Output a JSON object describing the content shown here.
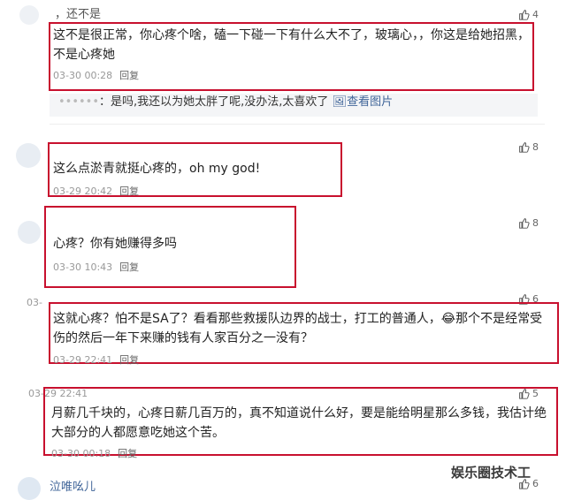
{
  "comments": [
    {
      "username": "，还不是",
      "text": "这不是很正常，你心疼个啥，磕一下碰一下有什么大不了，玻璃心，，你这是给她招黑，不是心疼她",
      "time": "03-30 00:28",
      "reply_label": "回复",
      "likes": "4",
      "subreply": {
        "username": "••••••",
        "text": "：是吗,我还以为她太胖了呢,没办法,太喜欢了",
        "image_link": "查看图片"
      }
    },
    {
      "username": "",
      "text": "这么点淤青就挺心疼的，oh my god!",
      "time": "03-29 20:42",
      "reply_label": "回复",
      "likes": "8"
    },
    {
      "username": "",
      "text": "心疼？你有她赚得多吗",
      "time": "03-30 10:43",
      "reply_label": "回复",
      "likes": "8"
    },
    {
      "username": "03-",
      "text": "这就心疼？怕不是SA了？看看那些救援队边界的战士，打工的普通人，😂那个不是经常受伤的然后一年下来赚的钱有人家百分之一没有？",
      "time": "03-29 22:41",
      "reply_label": "回复",
      "likes": "6"
    },
    {
      "username": "03-29 22:41",
      "text": "月薪几千块的，心疼日薪几百万的，真不知道说什么好，要是能给明星那么多钱，我估计绝大部分的人都愿意吃她这个苦。",
      "time": "03-30 00:18",
      "reply_label": "回复",
      "likes": "5"
    },
    {
      "username": "泣唯吆儿",
      "likes": "6"
    }
  ],
  "watermark": "娱乐圈技术工",
  "colors": {
    "highlight": "#c8102e",
    "link": "#406599"
  }
}
